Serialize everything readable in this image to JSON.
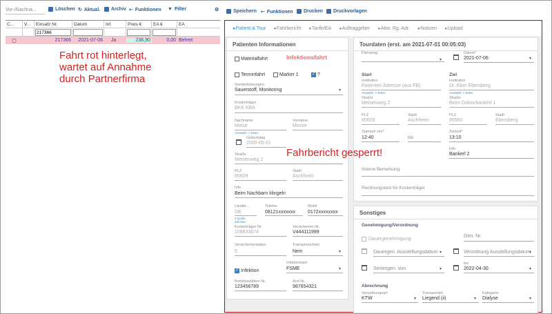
{
  "left": {
    "search_placeholder": "Vor-/Nachna...",
    "toolbar": {
      "delete": "Löschen",
      "refresh": "Aktual.",
      "archive": "Archiv",
      "functions": "Funktionen",
      "filter": "Filter"
    },
    "columns": [
      "C...",
      "V...",
      "Einsatz Nr.",
      "Datum",
      "Inf.",
      "Preis €",
      "EA €",
      "EA"
    ],
    "filter_value": "217366",
    "row": {
      "nr": "217366",
      "date": "2021-07-06",
      "inf": "Ja",
      "price": "236,90",
      "ea": "0,00",
      "ea2": "Befreit"
    },
    "note": [
      "Fahrt rot hinterlegt,",
      "wartet auf Annahme",
      "durch Partnerfirma"
    ]
  },
  "right_toolbar": {
    "save": "Speichern",
    "functions": "Funktionen",
    "print": "Drucken",
    "templates": "Druckvorlagen"
  },
  "tabs": [
    "Patient & Tour",
    "Fahrbericht",
    "Tarife/EA",
    "Auftraggeber",
    "Abw. Rg. Adr.",
    "Notizen",
    "Upload"
  ],
  "patient": {
    "title": "Patienten Informationen",
    "material": "Materialfahrt",
    "infekt": "Infektionsfahrt",
    "termin": "Terminfahrt",
    "marker": "Marker 1",
    "q": "?",
    "sonder_lbl": "Sonderleistungen",
    "sonder_val": "Sauerstoff, Monitoring",
    "kosten_lbl": "Kostenträger",
    "kosten_val": "BKK KBA",
    "nach_lbl": "Nachname",
    "nach_val": "Meise",
    "vor_lbl": "Vorname",
    "vor_val": "Minnie",
    "auswahl": "Auswahl -> Enter",
    "geb_lbl": "Geburtstag",
    "geb_val": "2000-05-01",
    "str_lbl": "Straße",
    "str_val": "Meisenweg 2",
    "plz_lbl": "PLZ",
    "plz_val": "85609",
    "stadt_lbl": "Stadt",
    "stadt_val": "Aschheim",
    "info_lbl": "Info",
    "info_val": "Beim Nachbarn klingeln",
    "land_lbl": "Länder...",
    "land_val": "DE",
    "land_hint": "2-große Zeichen",
    "tel_lbl": "Telefon",
    "tel_val": "08121xxxxxxx",
    "mob_lbl": "Mobil",
    "mob_val": "0172xxxxxxxx",
    "knr_lbl": "Kostenträger Nr.",
    "knr_val": "108833674",
    "vnr_lbl": "Versicherten Nr.",
    "vnr_val": "V444111999",
    "vst_lbl": "Versichertenstatus",
    "vst_val": "5",
    "tsch_lbl": "Transportschein",
    "tsch_val": "Nein",
    "infektion": "Infektion",
    "iart_lbl": "Infektionsart",
    "iart_val": "FSME",
    "bst_lbl": "Betriebsstätten Nr.",
    "bst_val": "123456789",
    "arzt_lbl": "Arzt Nr.",
    "arzt_val": "987654321"
  },
  "tour": {
    "title": "Tourdaten (erst. am 2021-07-01 00:05:03)",
    "fahrzeug_lbl": "Fahrzeug",
    "datum_lbl": "Datum*",
    "datum_val": "2021-07-06",
    "start": "Start",
    "ziel": "Ziel",
    "inst_lbl": "Institution",
    "s_inst_val": "Patienten Adresse (aus FB)",
    "z_inst_val": "Dr. Eber Ebersberg",
    "auswahl": "Auswahl -> Enter",
    "str_lbl": "Straße",
    "s_str_val": "Meisenweg 2",
    "z_str_val": "Beim Doktorbankerl 1",
    "plz_lbl": "PLZ",
    "stadt_lbl": "Stadt",
    "s_plz_val": "85609",
    "s_stadt_val": "Aschheim",
    "z_plz_val": "85560",
    "z_stadt_val": "Ebersberg",
    "sz_lbl": "Startzeit von*",
    "sz_val": "12:40",
    "bis": "bis",
    "zz_lbl": "Zielzeit*",
    "zz_val": "13:10",
    "info_lbl": "Info",
    "info_val": "Bankerl 2",
    "intern": "Interne Bemerkung",
    "rtext": "Rechnungstext für Kostenträger"
  },
  "sonst": {
    "title": "Sonstiges",
    "gen": "Genehmigung/Verordnung",
    "dauer": "Dauergenehmigung",
    "gen_nr": "Gen. Nr.",
    "dauer_dat": "Dauergen. Ausstellungsdatum",
    "ver_dat": "Verordnung Ausstellungsdatum",
    "serie": "Seriengen. von",
    "bis_lbl": "bis",
    "bis_val": "2022-04-30",
    "abr": "Abrechnung",
    "vart_lbl": "Verordnungsart",
    "vart_val": "KTW",
    "tart_lbl": "Transportart",
    "tart_val": "Liegend (ii)",
    "kat_lbl": "Kategorie",
    "kat_val": "Dialyse"
  },
  "gesperrt": "Fahrbericht gesperrt!"
}
